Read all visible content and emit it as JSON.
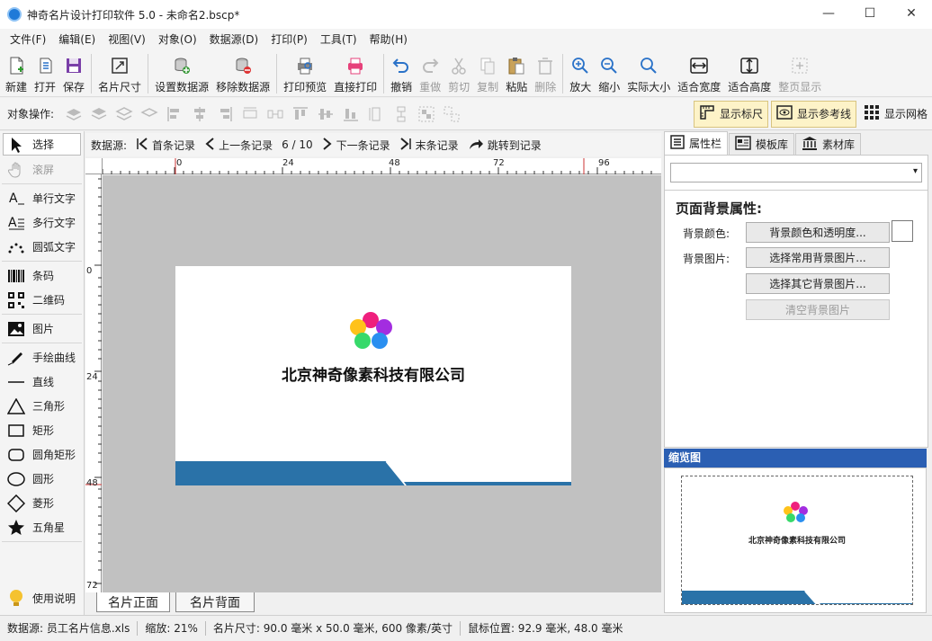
{
  "window": {
    "title": "神奇名片设计打印软件 5.0 - 未命名2.bscp*",
    "minimize": "—",
    "maximize": "☐",
    "close": "✕"
  },
  "menu": [
    "文件(F)",
    "编辑(E)",
    "视图(V)",
    "对象(O)",
    "数据源(D)",
    "打印(P)",
    "工具(T)",
    "帮助(H)"
  ],
  "toolbar": {
    "new": "新建",
    "open": "打开",
    "save": "保存",
    "card_size": "名片尺寸",
    "set_datasource": "设置数据源",
    "remove_datasource": "移除数据源",
    "print_preview": "打印预览",
    "direct_print": "直接打印",
    "undo": "撤销",
    "redo": "重做",
    "cut": "剪切",
    "copy": "复制",
    "paste": "粘贴",
    "delete": "删除",
    "zoom_in": "放大",
    "zoom_out": "缩小",
    "actual_size": "实际大小",
    "fit_width": "适合宽度",
    "fit_height": "适合高度",
    "fit_page": "整页显示"
  },
  "objbar": {
    "label": "对象操作:",
    "show_ruler": "显示标尺",
    "show_guides": "显示参考线",
    "show_grid": "显示网格"
  },
  "tools": {
    "select": "选择",
    "scroll": "滚屏",
    "single_text": "单行文字",
    "multi_text": "多行文字",
    "arc_text": "圆弧文字",
    "barcode": "条码",
    "qrcode": "二维码",
    "image": "图片",
    "freehand": "手绘曲线",
    "line": "直线",
    "triangle": "三角形",
    "rect": "矩形",
    "round_rect": "圆角矩形",
    "circle": "圆形",
    "diamond": "菱形",
    "star": "五角星",
    "help": "使用说明"
  },
  "records": {
    "label": "数据源:",
    "first": "首条记录",
    "prev": "上一条记录",
    "position": "6 / 10",
    "next": "下一条记录",
    "last": "末条记录",
    "jump": "跳转到记录"
  },
  "ruler": {
    "h_ticks": [
      "0",
      "24",
      "48",
      "72",
      "96"
    ],
    "v_ticks": [
      "0",
      "24",
      "48",
      "72"
    ]
  },
  "card": {
    "company": "北京神奇像素科技有限公司",
    "band_color": "#2a72a8",
    "logo_colors": [
      "#ef1f7d",
      "#a32de0",
      "#ffc21a",
      "#37d96a",
      "#2a8ff0"
    ]
  },
  "sheets": {
    "front": "名片正面",
    "back": "名片背面"
  },
  "right_tabs": {
    "properties": "属性栏",
    "templates": "模板库",
    "materials": "素材库"
  },
  "properties": {
    "combo_value": "",
    "heading": "页面背景属性:",
    "bg_color_label": "背景颜色:",
    "bg_color_button": "背景颜色和透明度...",
    "bg_image_label": "背景图片:",
    "common_bg_button": "选择常用背景图片...",
    "other_bg_button": "选择其它背景图片...",
    "clear_bg_button": "清空背景图片"
  },
  "preview": {
    "title": "缩览图"
  },
  "status": {
    "datasource": "数据源: 员工名片信息.xls",
    "zoom": "缩放: 21%",
    "card_size": "名片尺寸: 90.0 毫米 x 50.0 毫米, 600 像素/英寸",
    "mouse": "鼠标位置: 92.9 毫米, 48.0 毫米"
  }
}
